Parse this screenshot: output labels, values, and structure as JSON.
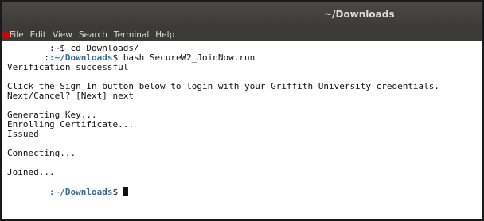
{
  "window": {
    "title": "~/Downloads"
  },
  "menubar": {
    "items": [
      "File",
      "Edit",
      "View",
      "Search",
      "Terminal",
      "Help"
    ]
  },
  "terminal": {
    "line1_prompt": ":~$",
    "line1_command": " cd Downloads/",
    "line2_prefix": ":",
    "line2_path": ":~/Downloads",
    "line2_suffix": "$",
    "line2_command": " bash SecureW2_JoinNow.run",
    "line3": "Verification successful",
    "line4": "Click the Sign In button below to login with your Griffith University credentials.",
    "line5": "Next/Cancel? [Next] next",
    "line6": "Generating Key...",
    "line7": "Enrolling Certificate...",
    "line8": "Issued",
    "line9": "Connecting...",
    "line10": "Joined...",
    "final_prompt_path": ":~/Downloads",
    "final_prompt_suffix": "$ "
  },
  "colors": {
    "titlebar": "#3b3a37",
    "prompt_path": "#2c6e9c",
    "annotation_arrow": "#e00000"
  },
  "icons": {
    "annotation": "red-arrow-icon"
  }
}
